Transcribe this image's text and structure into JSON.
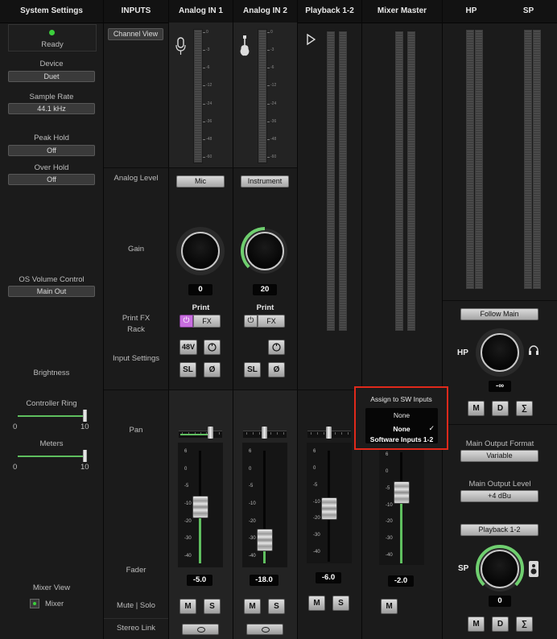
{
  "headers": {
    "system_settings": "System Settings",
    "inputs": "INPUTS",
    "analog_in_1": "Analog IN 1",
    "analog_in_2": "Analog IN 2",
    "playback_1_2": "Playback 1-2",
    "mixer_master": "Mixer Master",
    "hp": "HP",
    "sp": "SP"
  },
  "system": {
    "ready": "Ready",
    "device_label": "Device",
    "device_value": "Duet",
    "sample_rate_label": "Sample Rate",
    "sample_rate_value": "44.1 kHz",
    "peak_hold_label": "Peak Hold",
    "peak_hold_value": "Off",
    "over_hold_label": "Over Hold",
    "over_hold_value": "Off",
    "os_volume_label": "OS Volume Control",
    "os_volume_value": "Main Out",
    "brightness_label": "Brightness",
    "controller_ring_label": "Controller Ring",
    "controller_ring_min": "0",
    "controller_ring_max": "10",
    "controller_ring_level": 1.0,
    "meters_label": "Meters",
    "meters_min": "0",
    "meters_max": "10",
    "meters_level": 1.0,
    "mixer_view_label": "Mixer View",
    "mixer_view_option": "Mixer"
  },
  "inputs_col": {
    "channel_view": "Channel View",
    "analog_level": "Analog Level",
    "gain": "Gain",
    "print_fx_line1": "Print FX",
    "print_fx_line2": "Rack",
    "input_settings": "Input Settings",
    "pan": "Pan",
    "fader": "Fader",
    "mute_solo": "Mute | Solo",
    "stereo_link": "Stereo Link"
  },
  "meter_scale": [
    "0",
    "-3",
    "-6",
    "-12",
    "-24",
    "-36",
    "-48",
    "-60"
  ],
  "fader_scale": [
    "6",
    "0",
    "-5",
    "-10",
    "-20",
    "-30",
    "-40"
  ],
  "analog1": {
    "icon": "microphone-icon",
    "level": "Mic",
    "gain": "0",
    "gain_fraction": 0.0,
    "print": "Print",
    "fx": "FX",
    "phantom": "48V",
    "sl": "SL",
    "phase": "Ø",
    "fader": "-5.0",
    "mute": "M",
    "solo": "S"
  },
  "analog2": {
    "icon": "guitar-icon",
    "level": "Instrument",
    "gain": "20",
    "gain_fraction": 0.3,
    "print": "Print",
    "fx": "FX",
    "sl": "SL",
    "phase": "Ø",
    "fader": "-18.0",
    "mute": "M",
    "solo": "S"
  },
  "playback": {
    "icon": "play-icon",
    "fader": "-6.0",
    "mute": "M",
    "solo": "S"
  },
  "master": {
    "fader": "-2.0",
    "mute": "M",
    "dropdown": {
      "title": "Assign to SW Inputs",
      "current": "None",
      "options": [
        "None",
        "Software Inputs 1-2"
      ],
      "checked": "None"
    },
    "highlight_color": "#e0291b"
  },
  "hp_sp": {
    "follow_main": "Follow Main",
    "hp_label": "HP",
    "hp_value": "-∞",
    "hp_m": "M",
    "hp_d": "D",
    "hp_sum": "∑",
    "main_output_format_label": "Main Output Format",
    "main_output_format_value": "Variable",
    "main_output_level_label": "Main Output Level",
    "main_output_level_value": "+4 dBu",
    "sp_source": "Playback 1-2",
    "sp_label": "SP",
    "sp_value": "0",
    "sp_m": "M",
    "sp_d": "D",
    "sp_sum": "∑"
  },
  "colors": {
    "accent_green": "#5fbf5f",
    "fx_purple": "#c86ee0",
    "ready_green": "#3ccf3c"
  }
}
